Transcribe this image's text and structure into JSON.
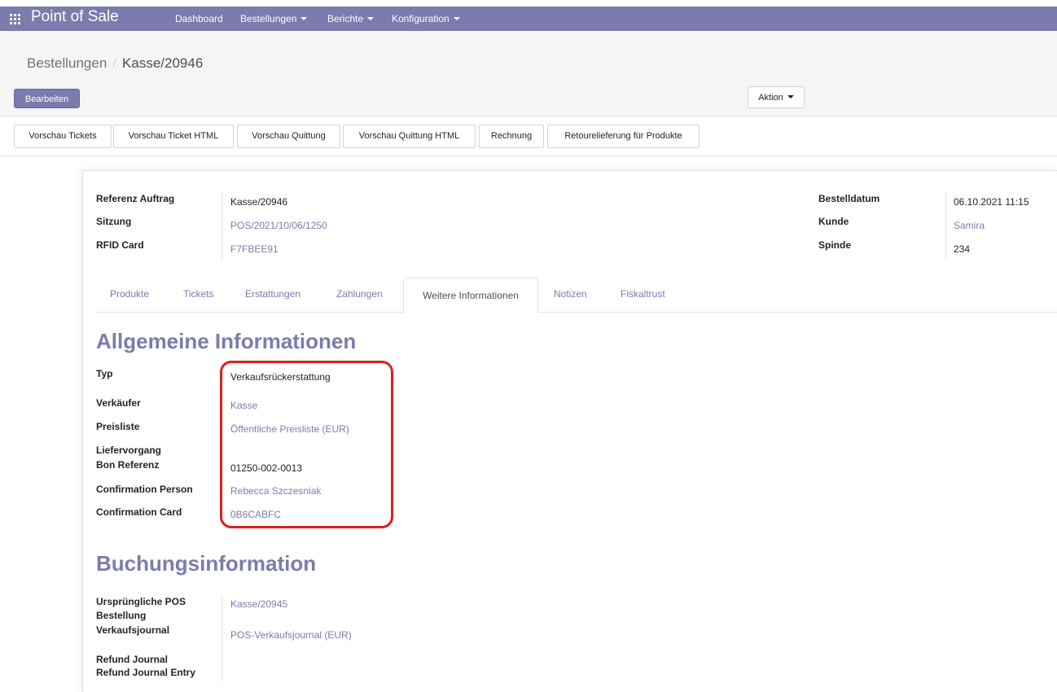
{
  "nav": {
    "app_title": "Point of Sale",
    "items": [
      {
        "label": "Dashboard"
      },
      {
        "label": "Bestellungen"
      },
      {
        "label": "Berichte"
      },
      {
        "label": "Konfiguration"
      }
    ]
  },
  "breadcrumb": {
    "parent": "Bestellungen",
    "separator": "/",
    "current": "Kasse/20946"
  },
  "toolbar": {
    "edit_label": "Bearbeiten",
    "action_label": "Aktion"
  },
  "header_buttons": [
    {
      "label": "Vorschau Tickets"
    },
    {
      "label": "Vorschau Ticket HTML"
    },
    {
      "label": "Vorschau Quittung"
    },
    {
      "label": "Vorschau Quittung HTML"
    },
    {
      "label": "Rechnung"
    },
    {
      "label": "Retourelieferung für Produkte"
    }
  ],
  "order": {
    "ref_label": "Referenz Auftrag",
    "ref_value": "Kasse/20946",
    "session_label": "Sitzung",
    "session_value": "POS/2021/10/06/1250",
    "rfid_label": "RFID Card",
    "rfid_value": "F7FBEE91",
    "date_label": "Bestelldatum",
    "date_value": "06.10.2021 11:15",
    "customer_label": "Kunde",
    "customer_value": "Samira",
    "locker_label": "Spinde",
    "locker_value": "234"
  },
  "tabs": [
    {
      "label": "Produkte"
    },
    {
      "label": "Tickets"
    },
    {
      "label": "Erstattungen"
    },
    {
      "label": "Zahlungen"
    },
    {
      "label": "Weitere Informationen"
    },
    {
      "label": "Notizen"
    },
    {
      "label": "Fiskaltrust"
    }
  ],
  "general": {
    "heading": "Allgemeine Informationen",
    "type_label": "Typ",
    "type_value": "Verkaufsrückerstattung",
    "seller_label": "Verkäufer",
    "seller_value": "Kasse",
    "pricelist_label": "Preisliste",
    "pricelist_value": "Öffentliche Preisliste (EUR)",
    "delivery_label": "Liefervorgang",
    "bon_label": "Bon Referenz",
    "bon_value": "01250-002-0013",
    "conf_person_label": "Confirmation Person",
    "conf_person_value": "Rebecca Szczesniak",
    "conf_card_label": "Confirmation Card",
    "conf_card_value": "0B6CABFC"
  },
  "booking": {
    "heading": "Buchungsinformation",
    "orig_label_1": "Ursprüngliche POS",
    "orig_label_2": "Bestellung",
    "orig_value": "Kasse/20945",
    "journal_label": "Verkaufsjournal",
    "journal_value": "POS-Verkaufsjournal (EUR)",
    "refund_journal_label": "Refund Journal",
    "refund_entry_label": "Refund Journal Entry"
  },
  "colors": {
    "brand": "#7c7bad",
    "highlight": "#e01e1e"
  }
}
